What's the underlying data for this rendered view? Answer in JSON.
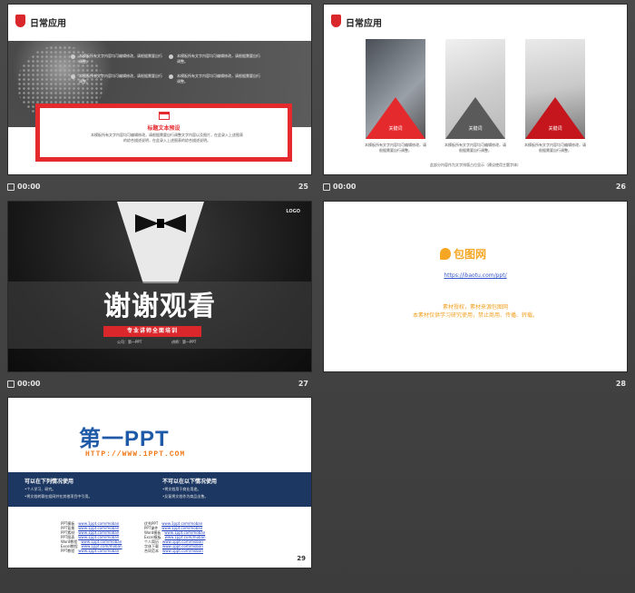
{
  "slides": {
    "s25": {
      "title": "日常应用",
      "bullet1": "本模板所有文字内容均可编辑修改，请根据需要自行调整。",
      "bullet2": "本模板所有文字内容均可编辑修改，请根据需要自行调整。",
      "bullet3": "本模板所有文字内容均可编辑修改，请根据需要自行调整。",
      "bullet4": "本模板所有文字内容均可编辑修改，请根据需要自行调整。",
      "box_title": "标题文本预设",
      "box_text": "本模板所有文字内容均可编辑修改，请根据需要自行调整文字内容以及图片，在此录入上述图表的综合描述说明，在此录入上述图表的综合描述说明。",
      "time": "00:00",
      "number": "25"
    },
    "s26": {
      "title": "日常应用",
      "card_label": "关键词",
      "cap1": "本模板所有文字内容均可编辑修改，请根据需要自行调整。",
      "cap2": "本模板所有文字内容均可编辑修改，请根据需要自行调整。",
      "cap3": "本模板所有文字内容均可编辑修改，请根据需要自行调整。",
      "footer": "此部分内容作为文字排版占位显示（建议使用主题字体）",
      "time": "00:00",
      "number": "26"
    },
    "s27": {
      "logo": "LOGO",
      "heading": "谢谢观看",
      "subtitle": "专业讲师全面培训",
      "company": "公司：第一PPT",
      "lecturer": "讲师：第一PPT",
      "time": "00:00",
      "number": "27"
    },
    "s28": {
      "brand": "包图网",
      "link": "https://ibaotu.com/ppt/",
      "note1": "素材授权，素材来源包图网",
      "note2": "本素材仅供学习研究使用，禁止商用、传播、转载。",
      "number": "28"
    },
    "s29": {
      "logo_text": "第一PPT",
      "url": "HTTP://WWW.1PPT.COM",
      "left_heading": "可以在下列情况使用",
      "left_item1": "•个人学习、研究。",
      "left_item2": "•将文档转载在组网并在其他项目中引用。",
      "right_heading": "不可以在以下情况使用",
      "right_item1": "•将文档用于商业用途。",
      "right_item2": "•反复将文档作为商品出售。",
      "links_left": [
        "PPT模板",
        "PPT背景",
        "PPT素材",
        "PPT图表",
        "Word教程",
        "Excel教程",
        "PPT教程"
      ],
      "links_right": [
        "优秀PPT",
        "PPT课件",
        "Word模板",
        "Excel模板",
        "个人简历",
        "字体下载",
        "合同范本"
      ],
      "link_url": "www.1ppt.com/moban",
      "number": "29"
    }
  },
  "colors": {
    "accent_red": "#d9272c",
    "brand_orange": "#f5a623",
    "navy": "#1c3761",
    "ppt_blue": "#1f5aa8"
  }
}
